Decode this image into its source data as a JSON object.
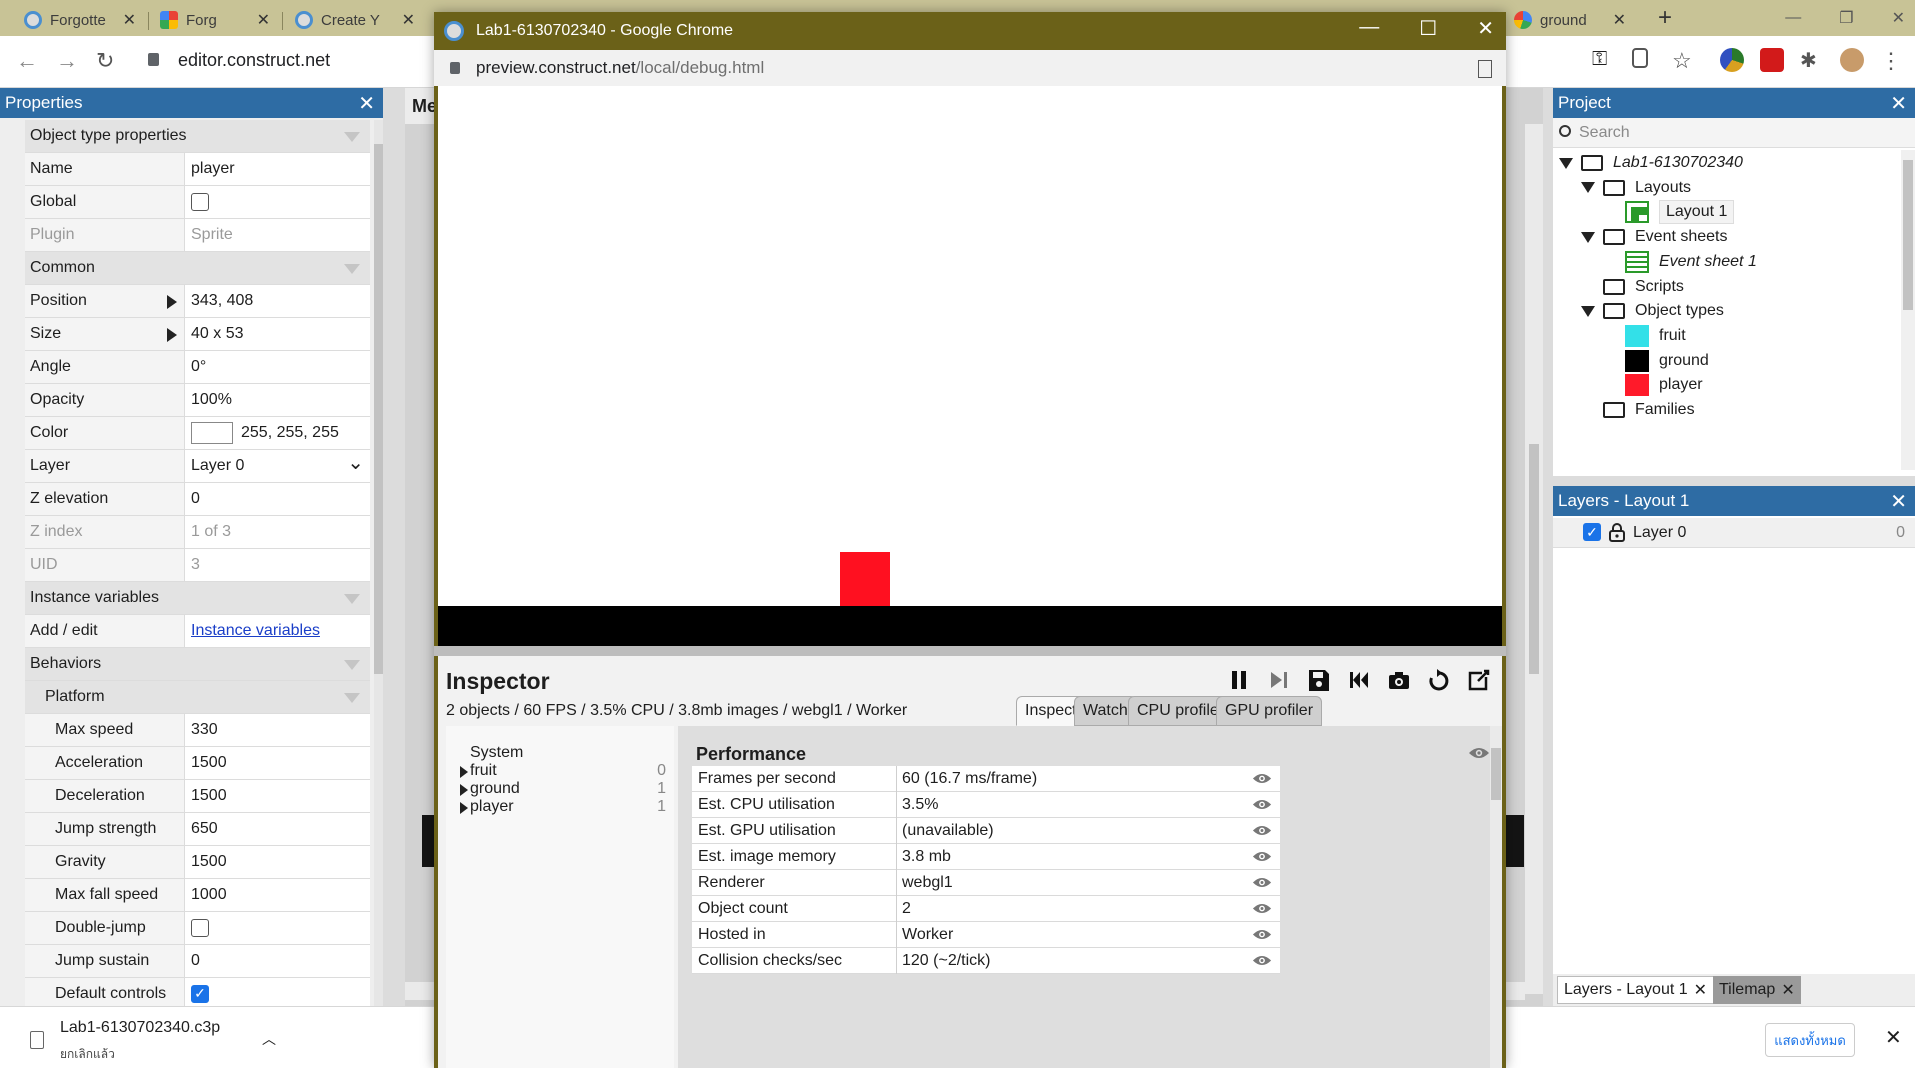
{
  "browser": {
    "tabs": [
      {
        "label": "Forgotte",
        "icon": "chrome-icon"
      },
      {
        "label": "Forg",
        "icon": "gmail-icon"
      },
      {
        "label": "Create Y",
        "icon": "chrome-icon"
      },
      {
        "label": "",
        "icon": "chrome-icon"
      },
      {
        "label": "ground",
        "icon": "google-icon"
      }
    ],
    "new_tab": "+",
    "url": "editor.construct.net"
  },
  "properties": {
    "title": "Properties",
    "rows": [
      {
        "type": "section",
        "label": "Object type properties"
      },
      {
        "label": "Name",
        "value": "player"
      },
      {
        "label": "Global",
        "checkbox": false
      },
      {
        "label": "Plugin",
        "value": "Sprite",
        "disabled": true
      },
      {
        "type": "section",
        "label": "Common"
      },
      {
        "label": "Position",
        "value": "343, 408",
        "expand": true
      },
      {
        "label": "Size",
        "value": "40 x 53",
        "expand": true
      },
      {
        "label": "Angle",
        "value": "0°"
      },
      {
        "label": "Opacity",
        "value": "100%"
      },
      {
        "label": "Color",
        "value": "255, 255, 255",
        "swatch": "#ffffff"
      },
      {
        "label": "Layer",
        "value": "Layer 0",
        "dropdown": true
      },
      {
        "label": "Z elevation",
        "value": "0"
      },
      {
        "label": "Z index",
        "value": "1 of 3",
        "disabled": true
      },
      {
        "label": "UID",
        "value": "3",
        "disabled": true
      },
      {
        "type": "section",
        "label": "Instance variables"
      },
      {
        "label": "Add / edit",
        "link": "Instance variables"
      },
      {
        "type": "section",
        "label": "Behaviors"
      },
      {
        "type": "section",
        "label": "Platform",
        "sub": true
      },
      {
        "label": "Max speed",
        "value": "330",
        "sub": true
      },
      {
        "label": "Acceleration",
        "value": "1500",
        "sub": true
      },
      {
        "label": "Deceleration",
        "value": "1500",
        "sub": true
      },
      {
        "label": "Jump strength",
        "value": "650",
        "sub": true
      },
      {
        "label": "Gravity",
        "value": "1500",
        "sub": true
      },
      {
        "label": "Max fall speed",
        "value": "1000",
        "sub": true
      },
      {
        "label": "Double-jump",
        "checkbox": false,
        "sub": true
      },
      {
        "label": "Jump sustain",
        "value": "0",
        "sub": true
      },
      {
        "label": "Default controls",
        "checkbox": true,
        "sub": true
      }
    ]
  },
  "layout_tab": "Me",
  "project": {
    "title": "Project",
    "search_placeholder": "Search",
    "items": [
      {
        "label": "Lab1-6130702340",
        "kind": "folder",
        "caret": true,
        "italic": true,
        "depth": 0
      },
      {
        "label": "Layouts",
        "kind": "folder",
        "caret": true,
        "depth": 1
      },
      {
        "label": "Layout 1",
        "kind": "layout",
        "depth": 2
      },
      {
        "label": "Event sheets",
        "kind": "folder",
        "caret": true,
        "depth": 1
      },
      {
        "label": "Event sheet 1",
        "kind": "eventsheet",
        "italic": true,
        "depth": 2
      },
      {
        "label": "Scripts",
        "kind": "folder",
        "depth": 1
      },
      {
        "label": "Object types",
        "kind": "folder",
        "caret": true,
        "depth": 1
      },
      {
        "label": "fruit",
        "kind": "object",
        "color": "#33e0e8",
        "depth": 2
      },
      {
        "label": "ground",
        "kind": "object",
        "color": "#000000",
        "depth": 2
      },
      {
        "label": "player",
        "kind": "object",
        "color": "#ff1a2a",
        "depth": 2
      },
      {
        "label": "Families",
        "kind": "folder",
        "depth": 1
      }
    ]
  },
  "layers": {
    "title": "Layers - Layout 1",
    "items": [
      {
        "label": "Layer 0",
        "visible": true,
        "locked": true,
        "index": "0"
      }
    ],
    "tabs": [
      "Layers - Layout 1",
      "Tilemap"
    ]
  },
  "popup": {
    "title": "Lab1-6130702340 - Google Chrome",
    "url_host": "preview.construct.net",
    "url_path": "/local/debug.html"
  },
  "inspector": {
    "title": "Inspector",
    "stats": "2 objects / 60 FPS / 3.5% CPU / 3.8mb images / webgl1 / Worker",
    "tabs": [
      "Inspect",
      "Watch",
      "CPU profiler",
      "GPU profiler"
    ],
    "objects": [
      {
        "name": "System",
        "count": ""
      },
      {
        "name": "fruit",
        "count": "0"
      },
      {
        "name": "ground",
        "count": "1"
      },
      {
        "name": "player",
        "count": "1"
      }
    ],
    "section": "Performance",
    "perf": [
      {
        "label": "Frames per second",
        "value": "60 (16.7 ms/frame)"
      },
      {
        "label": "Est. CPU utilisation",
        "value": "3.5%"
      },
      {
        "label": "Est. GPU utilisation",
        "value": "(unavailable)"
      },
      {
        "label": "Est. image memory",
        "value": "3.8 mb"
      },
      {
        "label": "Renderer",
        "value": "webgl1"
      },
      {
        "label": "Object count",
        "value": "2"
      },
      {
        "label": "Hosted in",
        "value": "Worker"
      },
      {
        "label": "Collision checks/sec",
        "value": "120 (~2/tick)"
      }
    ]
  },
  "download": {
    "file": "Lab1-6130702340.c3p",
    "status": "ยกเลิกแล้ว",
    "show_all": "แสดงทั้งหมด"
  },
  "colors": {
    "panel_header": "#2e6ca4",
    "popup_frame": "#6b6118",
    "player": "#ff1020",
    "fruit": "#33e0e8"
  }
}
